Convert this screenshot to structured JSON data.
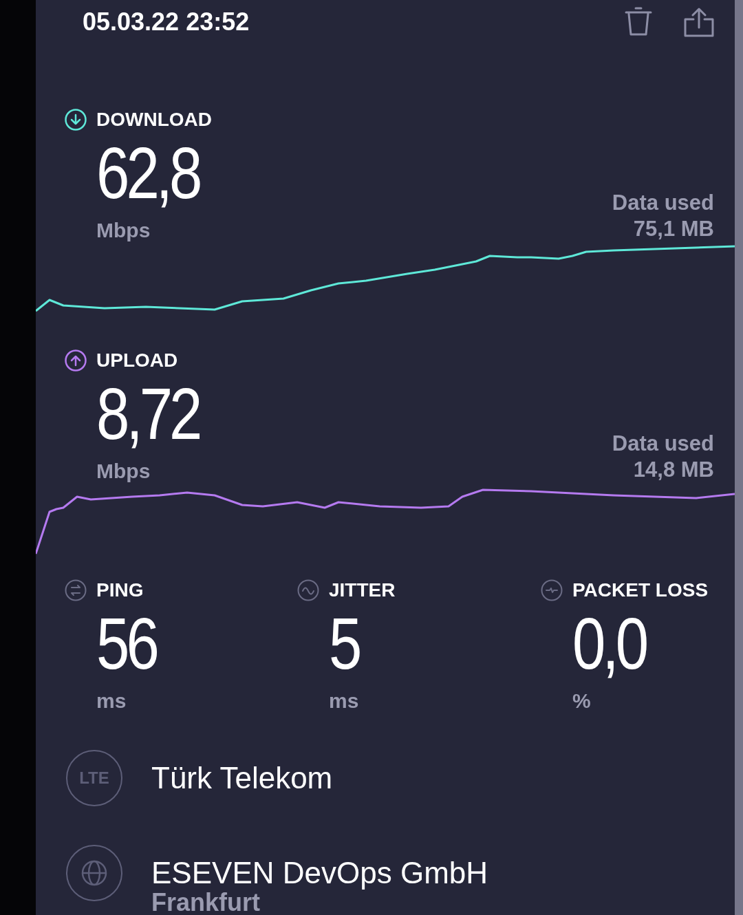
{
  "header": {
    "datetime": "05.03.22 23:52"
  },
  "speeds": [
    {
      "kind": "download",
      "label": "DOWNLOAD",
      "value": "62,8",
      "unit": "Mbps",
      "data_used_label": "Data used",
      "data_used": "75,1 MB",
      "color": "#5ee8d8"
    },
    {
      "kind": "upload",
      "label": "UPLOAD",
      "value": "8,72",
      "unit": "Mbps",
      "data_used_label": "Data used",
      "data_used": "14,8 MB",
      "color": "#b57af0"
    }
  ],
  "metrics": [
    {
      "kind": "ping",
      "label": "PING",
      "value": "56",
      "unit": "ms"
    },
    {
      "kind": "jitter",
      "label": "JITTER",
      "value": "5",
      "unit": "ms"
    },
    {
      "kind": "packet_loss",
      "label": "PACKET LOSS",
      "value": "0,0",
      "unit": "%"
    }
  ],
  "network": [
    {
      "kind": "carrier",
      "badge": "LTE",
      "name": "Türk Telekom"
    },
    {
      "kind": "server",
      "name": "ESEVEN DevOps GmbH",
      "location": "Frankfurt"
    }
  ]
}
